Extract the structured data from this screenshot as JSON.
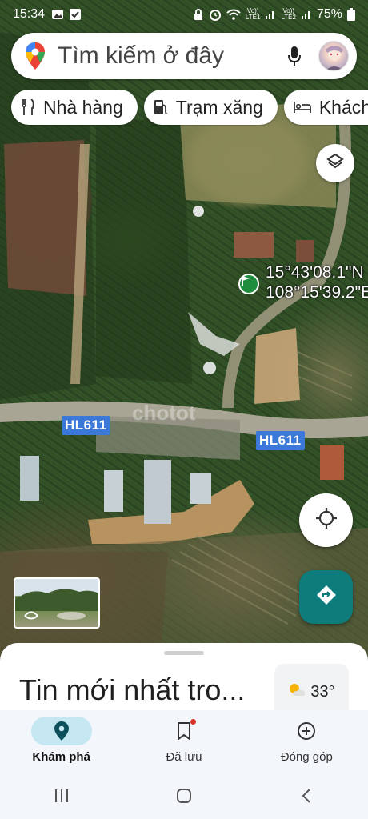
{
  "status_bar": {
    "time": "15:34",
    "network_1": "LTE1",
    "network_2": "LTE2",
    "battery": "75%"
  },
  "search": {
    "placeholder": "Tìm kiếm ở đây",
    "icons": [
      "google-maps-pin-icon",
      "mic-icon",
      "avatar"
    ]
  },
  "chips": [
    {
      "label": "Nhà hàng",
      "icon": "restaurant-icon"
    },
    {
      "label": "Trạm xăng",
      "icon": "gas-station-icon"
    },
    {
      "label": "Khách sạn",
      "icon": "hotel-icon"
    }
  ],
  "map": {
    "type": "satellite",
    "coordinates": {
      "lat": "15°43'08.1\"N",
      "lng": "108°15'39.2\"E"
    },
    "road_labels": [
      "HL611",
      "HL611"
    ],
    "watermark": "chotot"
  },
  "sheet": {
    "title": "Tin mới nhất tro...",
    "weather_temp": "33°"
  },
  "bottom_nav": {
    "items": [
      {
        "label": "Khám phá",
        "icon": "explore-pin-icon",
        "active": true
      },
      {
        "label": "Đã lưu",
        "icon": "bookmark-icon",
        "active": false,
        "has_badge": true
      },
      {
        "label": "Đóng góp",
        "icon": "add-circle-icon",
        "active": false
      }
    ]
  },
  "colors": {
    "accent_teal": "#0e7c7b",
    "road_label_blue": "#3c78d8",
    "active_nav_bg": "#c4e7f2",
    "pin_green": "#1e8e3e"
  }
}
